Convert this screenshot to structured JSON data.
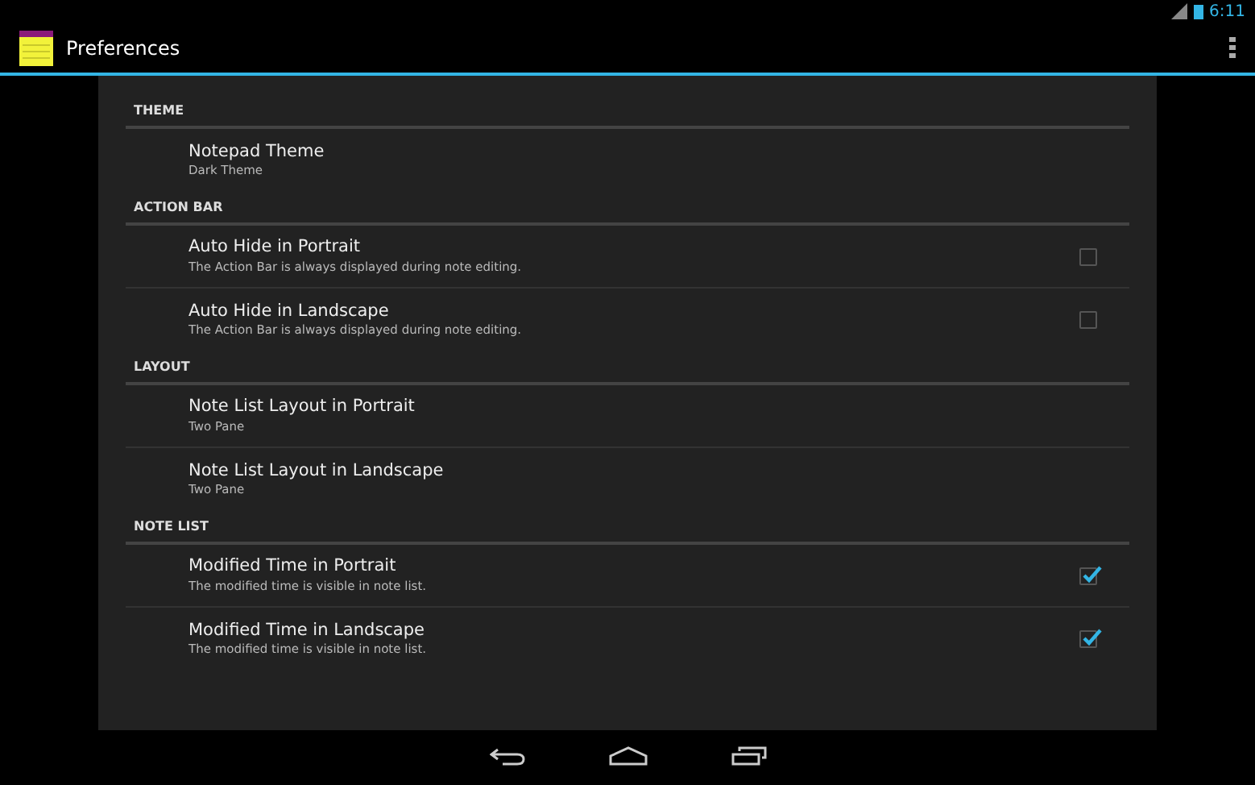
{
  "status_bar": {
    "time": "6:11"
  },
  "action_bar": {
    "title": "Preferences"
  },
  "sections": [
    {
      "title": "THEME",
      "items": [
        {
          "kind": "list",
          "title": "Notepad Theme",
          "summary": "Dark Theme"
        }
      ]
    },
    {
      "title": "ACTION BAR",
      "items": [
        {
          "kind": "checkbox",
          "title": "Auto Hide in Portrait",
          "summary": "The Action Bar is always displayed during note editing.",
          "checked": false
        },
        {
          "kind": "checkbox",
          "title": "Auto Hide in Landscape",
          "summary": "The Action Bar is always displayed during note editing.",
          "checked": false
        }
      ]
    },
    {
      "title": "LAYOUT",
      "items": [
        {
          "kind": "list",
          "title": "Note List Layout in Portrait",
          "summary": "Two Pane"
        },
        {
          "kind": "list",
          "title": "Note List Layout in Landscape",
          "summary": "Two Pane"
        }
      ]
    },
    {
      "title": "NOTE LIST",
      "items": [
        {
          "kind": "checkbox",
          "title": "Modified Time in Portrait",
          "summary": "The modified time is visible in note list.",
          "checked": true
        },
        {
          "kind": "checkbox",
          "title": "Modified Time in Landscape",
          "summary": "The modified time is visible in note list.",
          "checked": true
        }
      ]
    }
  ]
}
